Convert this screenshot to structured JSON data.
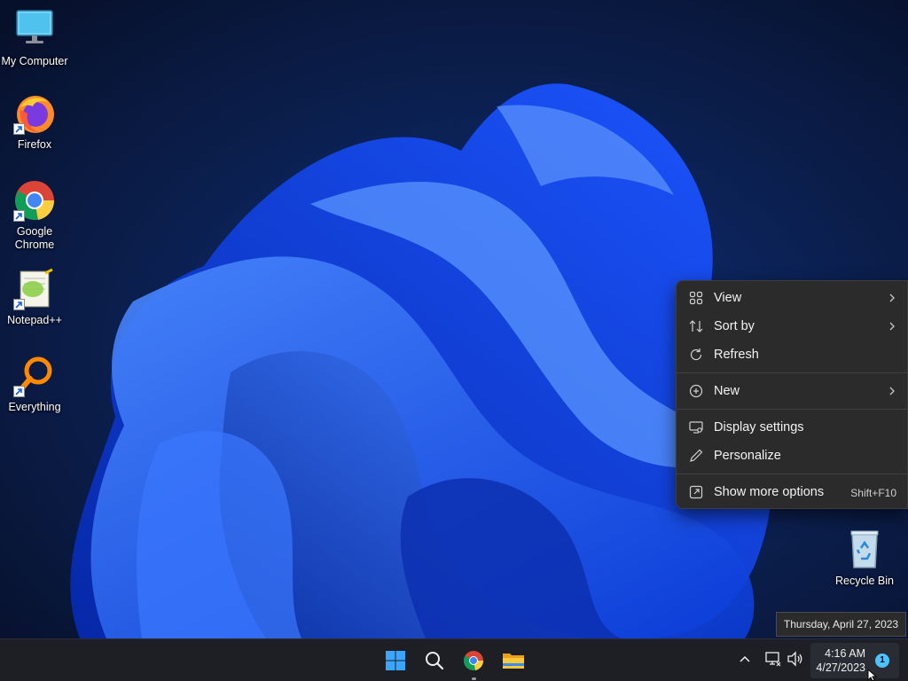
{
  "desktop": {
    "icons": [
      {
        "label": "My Computer"
      },
      {
        "label": "Firefox"
      },
      {
        "label": "Google Chrome"
      },
      {
        "label": "Notepad++"
      },
      {
        "label": "Everything"
      },
      {
        "label": "Recycle Bin"
      }
    ]
  },
  "context_menu": {
    "items": [
      {
        "label": "View",
        "icon": "grid-icon",
        "submenu": true
      },
      {
        "label": "Sort by",
        "icon": "sort-icon",
        "submenu": true
      },
      {
        "label": "Refresh",
        "icon": "refresh-icon"
      },
      {
        "label": "New",
        "icon": "plus-circle-icon",
        "submenu": true
      },
      {
        "label": "Display settings",
        "icon": "display-settings-icon"
      },
      {
        "label": "Personalize",
        "icon": "pen-icon"
      },
      {
        "label": "Show more options",
        "icon": "external-icon",
        "shortcut": "Shift+F10"
      }
    ]
  },
  "tooltip": {
    "text": "Thursday, April 27, 2023"
  },
  "taskbar": {
    "apps": [
      "start-icon",
      "search-icon",
      "chrome-icon",
      "file-explorer-icon"
    ],
    "tray": {
      "time": "4:16 AM",
      "date": "4/27/2023",
      "notification_count": "1"
    }
  },
  "colors": {
    "menu_bg": "#2b2b2b",
    "taskbar_bg": "#1d1f25",
    "accent": "#4cc2ff"
  }
}
